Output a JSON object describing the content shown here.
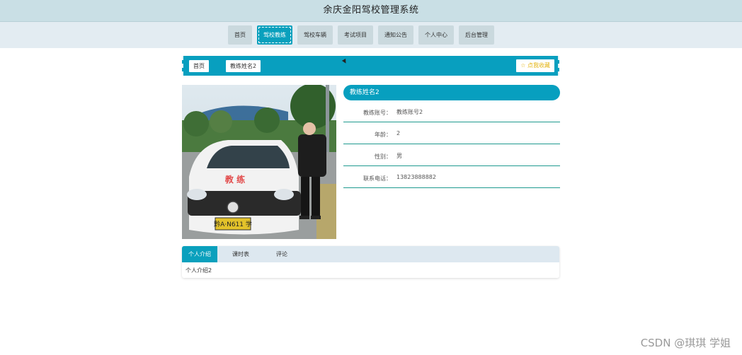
{
  "app": {
    "title": "余庆金阳驾校管理系统"
  },
  "nav": {
    "items": [
      {
        "label": "首页"
      },
      {
        "label": "驾校教练"
      },
      {
        "label": "驾校车辆"
      },
      {
        "label": "考试项目"
      },
      {
        "label": "通知公告"
      },
      {
        "label": "个人中心"
      },
      {
        "label": "后台管理"
      }
    ],
    "active_index": 1
  },
  "breadcrumb": {
    "home": "首页",
    "current": "教练姓名2"
  },
  "favorite": {
    "label": "☆ 点我收藏"
  },
  "detail": {
    "name": "教练姓名2",
    "fields": [
      {
        "label": "教练账号：",
        "value": "教练账号2"
      },
      {
        "label": "年龄：",
        "value": "2"
      },
      {
        "label": "性别：",
        "value": "男"
      },
      {
        "label": "联系电话：",
        "value": "13823888882"
      }
    ]
  },
  "photo": {
    "car_brand_text": "教 练",
    "plate": "黔A·N611 学"
  },
  "tabs": {
    "items": [
      {
        "label": "个人介绍"
      },
      {
        "label": "课时表"
      },
      {
        "label": "评论"
      }
    ],
    "active_index": 0,
    "content": "个人介绍2"
  },
  "watermark": "CSDN @琪琪 学姐",
  "colors": {
    "accent": "#0aa0bd",
    "header_bg": "#c9dfe5",
    "nav_bg": "#e3ecf2",
    "favorite_text": "#e3b515",
    "divider": "#1f9a8f"
  }
}
